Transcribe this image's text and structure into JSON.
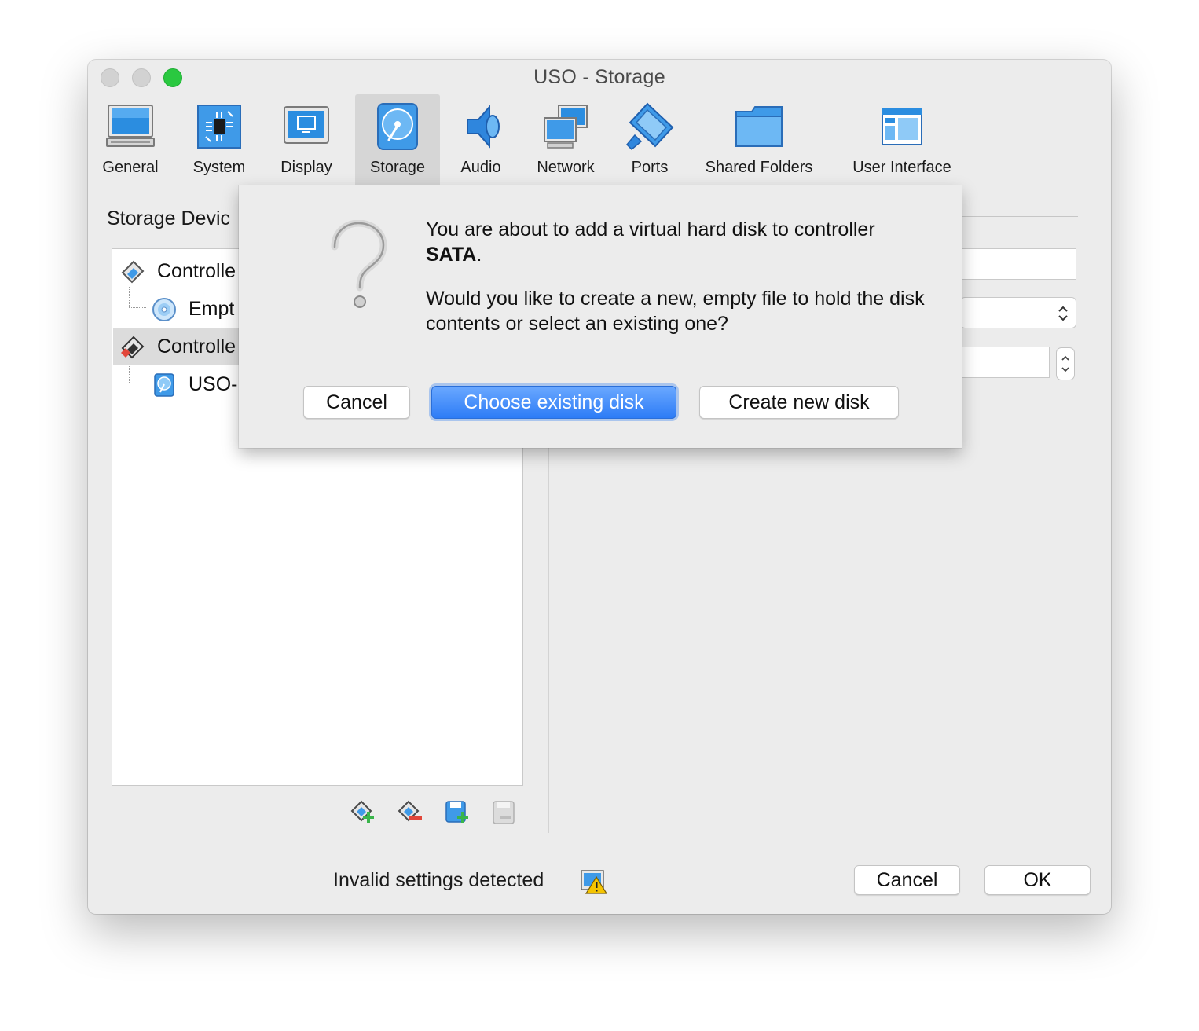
{
  "window": {
    "title": "USO - Storage"
  },
  "toolbar": {
    "items": [
      {
        "label": "General",
        "icon": "general-monitor-icon",
        "selected": false
      },
      {
        "label": "System",
        "icon": "system-chip-icon",
        "selected": false
      },
      {
        "label": "Display",
        "icon": "display-icon",
        "selected": false
      },
      {
        "label": "Storage",
        "icon": "storage-disk-icon",
        "selected": true
      },
      {
        "label": "Audio",
        "icon": "audio-speaker-icon",
        "selected": false
      },
      {
        "label": "Network",
        "icon": "network-icon",
        "selected": false
      },
      {
        "label": "Ports",
        "icon": "ports-connector-icon",
        "selected": false
      },
      {
        "label": "Shared Folders",
        "icon": "shared-folder-icon",
        "selected": false
      },
      {
        "label": "User Interface",
        "icon": "user-interface-icon",
        "selected": false
      }
    ]
  },
  "storage": {
    "section_title": "Storage Devic",
    "tree": [
      {
        "label": "Controlle",
        "icon": "ide-controller-icon",
        "level": 0,
        "selected": false
      },
      {
        "label": "Empt",
        "icon": "optical-disc-icon",
        "level": 1,
        "selected": false
      },
      {
        "label": "Controlle",
        "icon": "sata-controller-icon",
        "level": 0,
        "selected": true
      },
      {
        "label": "USO-",
        "icon": "hard-disk-icon",
        "level": 1,
        "selected": false
      }
    ],
    "tools": [
      "add-controller-icon",
      "remove-controller-icon",
      "add-attachment-icon",
      "remove-attachment-icon"
    ]
  },
  "dialog": {
    "message_line1_prefix": "You are about to add a virtual hard disk to controller ",
    "controller": "SATA",
    "message_line1_suffix": ".",
    "message_line2": "Would you like to create a new, empty file to hold the disk contents or select an existing one?",
    "buttons": {
      "cancel": "Cancel",
      "choose": "Choose existing disk",
      "create": "Create new disk"
    }
  },
  "status": {
    "text": "Invalid settings detected",
    "icon": "warning-icon"
  },
  "footer": {
    "cancel": "Cancel",
    "ok": "OK"
  },
  "colors": {
    "accent": "#2d7cf6",
    "zoom_button": "#2ac840",
    "window_bg": "#ececec"
  }
}
